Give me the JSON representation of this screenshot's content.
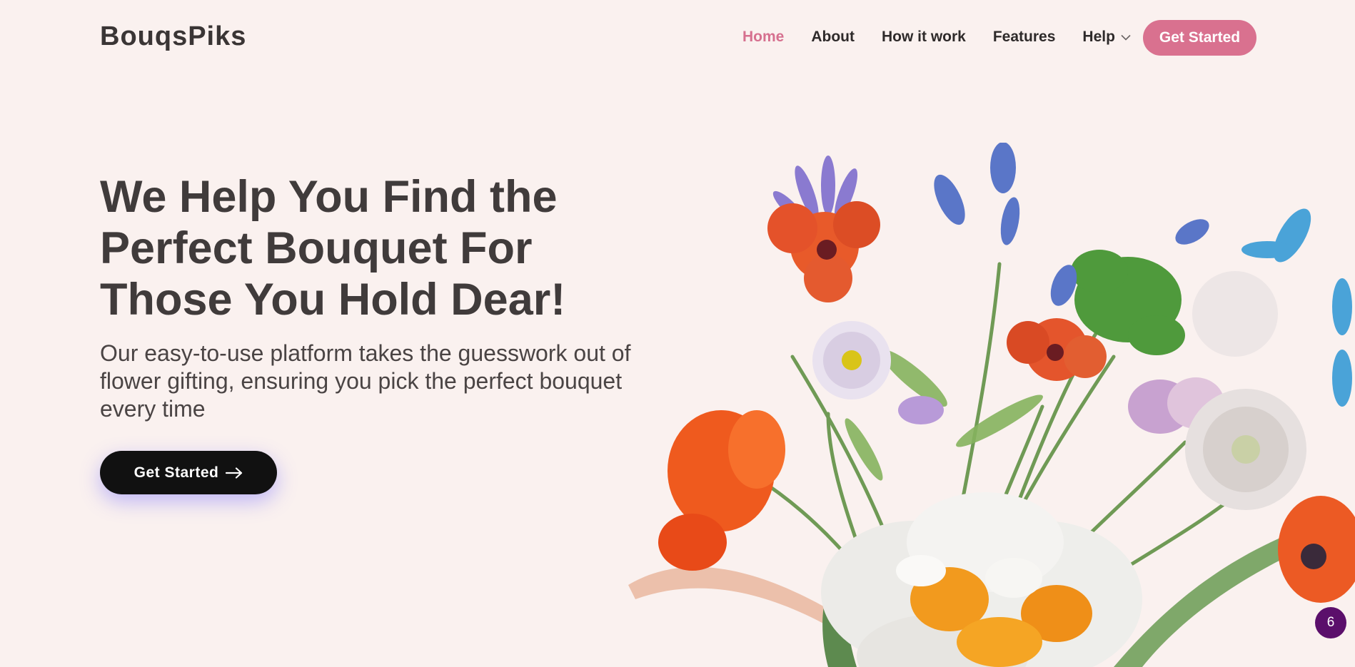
{
  "brand": {
    "name": "BouqsPiks"
  },
  "nav": {
    "items": [
      {
        "label": "Home",
        "active": true
      },
      {
        "label": "About",
        "active": false
      },
      {
        "label": "How it work",
        "active": false
      },
      {
        "label": "Features",
        "active": false
      },
      {
        "label": "Help",
        "active": false,
        "dropdown": true,
        "icon": "chevron-down-icon"
      }
    ],
    "cta_label": "Get Started"
  },
  "hero": {
    "title": "We Help You Find the Perfect Bouquet For Those You Hold Dear!",
    "subtitle": "Our easy-to-use platform takes the guesswork out of flower gifting, ensuring you pick the perfect bouquet every time",
    "cta_label": "Get Started",
    "cta_icon": "arrow-right-icon"
  },
  "badge": {
    "count": "6"
  },
  "colors": {
    "background": "#faf1ef",
    "accent": "#d9718f",
    "primary_button": "#111111",
    "badge": "#5b0f6b"
  }
}
